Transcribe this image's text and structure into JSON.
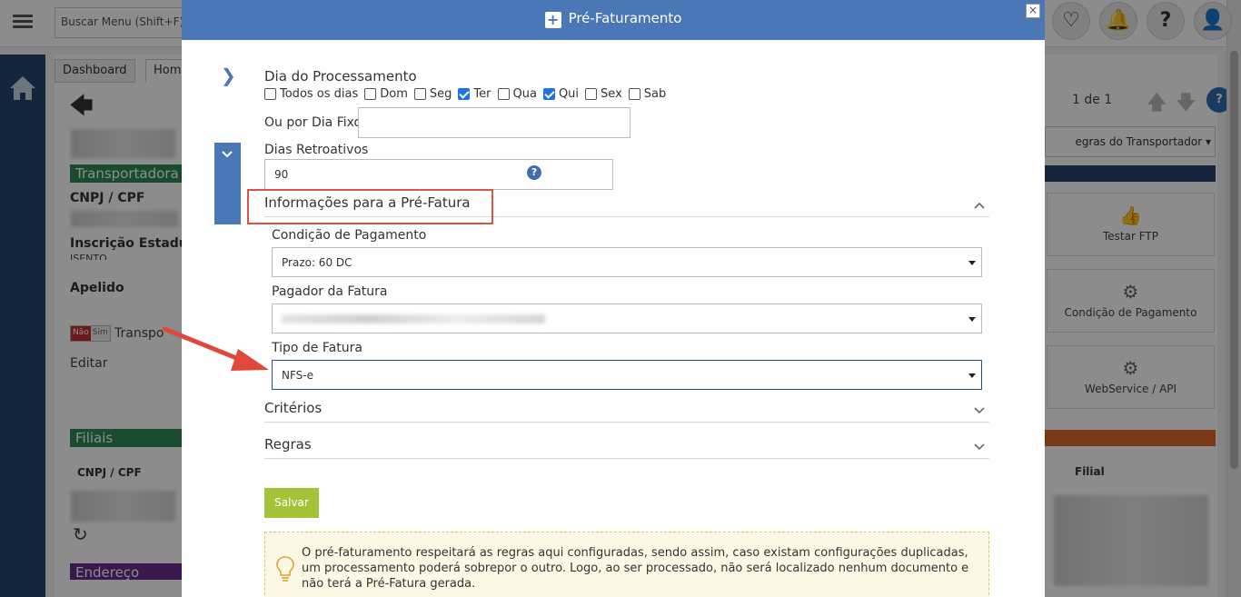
{
  "app": {
    "menu_search_placeholder": "Buscar Menu  (Shift+F)",
    "tabs": [
      "Dashboard",
      "Homo"
    ],
    "sections": {
      "transportadora": "Transportadora",
      "filiais": "Filiais",
      "endereco": "Endereço"
    },
    "labels": {
      "cnpj": "CNPJ / CPF",
      "inscricao": "Inscrição Estadual",
      "isento": "ISENTO",
      "apelido": "Apelido",
      "transp": "Transpo",
      "editar": "Editar",
      "filiais_cnpj": "CNPJ / CPF",
      "filial": "Filial"
    },
    "toggle": {
      "no": "Não",
      "yes": "Sim"
    },
    "pager": "1 de 1",
    "help_q": "?",
    "regras_dropdown": "egras do Transportador ▾",
    "cards": [
      "Testar FTP",
      "Condição de Pagamento",
      "WebService / API"
    ],
    "card_icons": [
      "thumbs-up-icon",
      "gear-icon",
      "gear-icon"
    ],
    "colors": {
      "sidebar": "#24466e",
      "section_green": "#2e8b57",
      "section_purple": "#6b2c8f",
      "accent_orange": "#e0672a"
    }
  },
  "modal": {
    "title": "Pré-Faturamento",
    "close": "×",
    "dia_processamento_label": "Dia do Processamento",
    "days": [
      {
        "label": "Todos os dias",
        "checked": false
      },
      {
        "label": "Dom",
        "checked": false
      },
      {
        "label": "Seg",
        "checked": false
      },
      {
        "label": "Ter",
        "checked": true
      },
      {
        "label": "Qua",
        "checked": false
      },
      {
        "label": "Qui",
        "checked": true
      },
      {
        "label": "Sex",
        "checked": false
      },
      {
        "label": "Sab",
        "checked": false
      }
    ],
    "dia_fixo_label": "Ou por Dia Fixo",
    "dia_fixo_value": "",
    "dias_retroativos_label": "Dias Retroativos",
    "dias_retroativos_value": "90",
    "help": "?",
    "info_prefatura_title": "Informações para a Pré-Fatura",
    "condicao_label": "Condição de Pagamento",
    "condicao_value": "Prazo: 60 DC",
    "pagador_label": "Pagador da Fatura",
    "tipo_label": "Tipo de Fatura",
    "tipo_value": "NFS-e",
    "criterios_title": "Critérios",
    "regras_title": "Regras",
    "save_label": "Salvar",
    "info_text": "O pré-faturamento respeitará as regras aqui configuradas, sendo assim, caso existam configurações duplicadas, um processamento poderá sobrepor o outro. Logo, ao ser processado, não será localizado nenhum documento e não terá a Pré-Fatura gerada.",
    "accent": "#4a77b5",
    "save_color": "#a5c339",
    "highlight_color": "#d9534f"
  }
}
